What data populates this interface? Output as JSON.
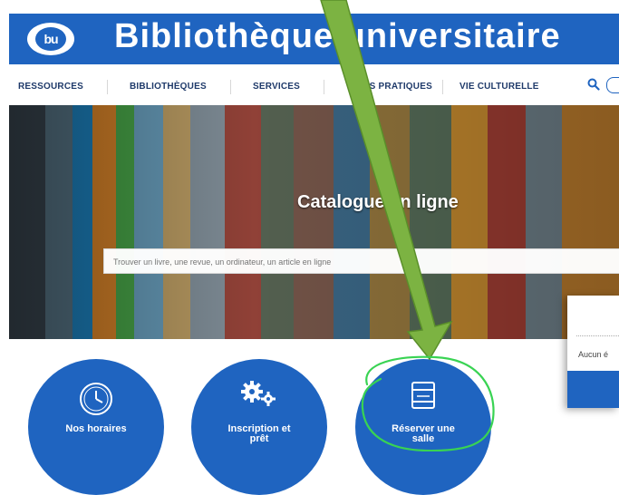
{
  "header": {
    "title": "Bibliothèque universitaire",
    "logo_text": "bu"
  },
  "nav": {
    "items": [
      {
        "label": "RESSOURCES"
      },
      {
        "label": "BIBLIOTHÈQUES"
      },
      {
        "label": "SERVICES"
      },
      {
        "label": "INFOS PRATIQUES"
      },
      {
        "label": "VIE CULTURELLE"
      }
    ],
    "search_icon": "search-icon"
  },
  "hero": {
    "title": "Catalogue en ligne",
    "search_placeholder": "Trouver un livre, une revue, un ordinateur, un article en ligne"
  },
  "popup": {
    "text": "Aucun é"
  },
  "tiles": [
    {
      "label_line1": "Nos horaires",
      "label_line2": "",
      "icon": "clock-icon"
    },
    {
      "label_line1": "Inscription et",
      "label_line2": "prêt",
      "icon": "gears-icon"
    },
    {
      "label_line1": "Réserver une",
      "label_line2": "salle",
      "icon": "room-booking-icon"
    }
  ],
  "colors": {
    "brand_blue": "#1f64c0",
    "annotation_arrow": "#7cb342",
    "annotation_circle": "#39d353"
  }
}
